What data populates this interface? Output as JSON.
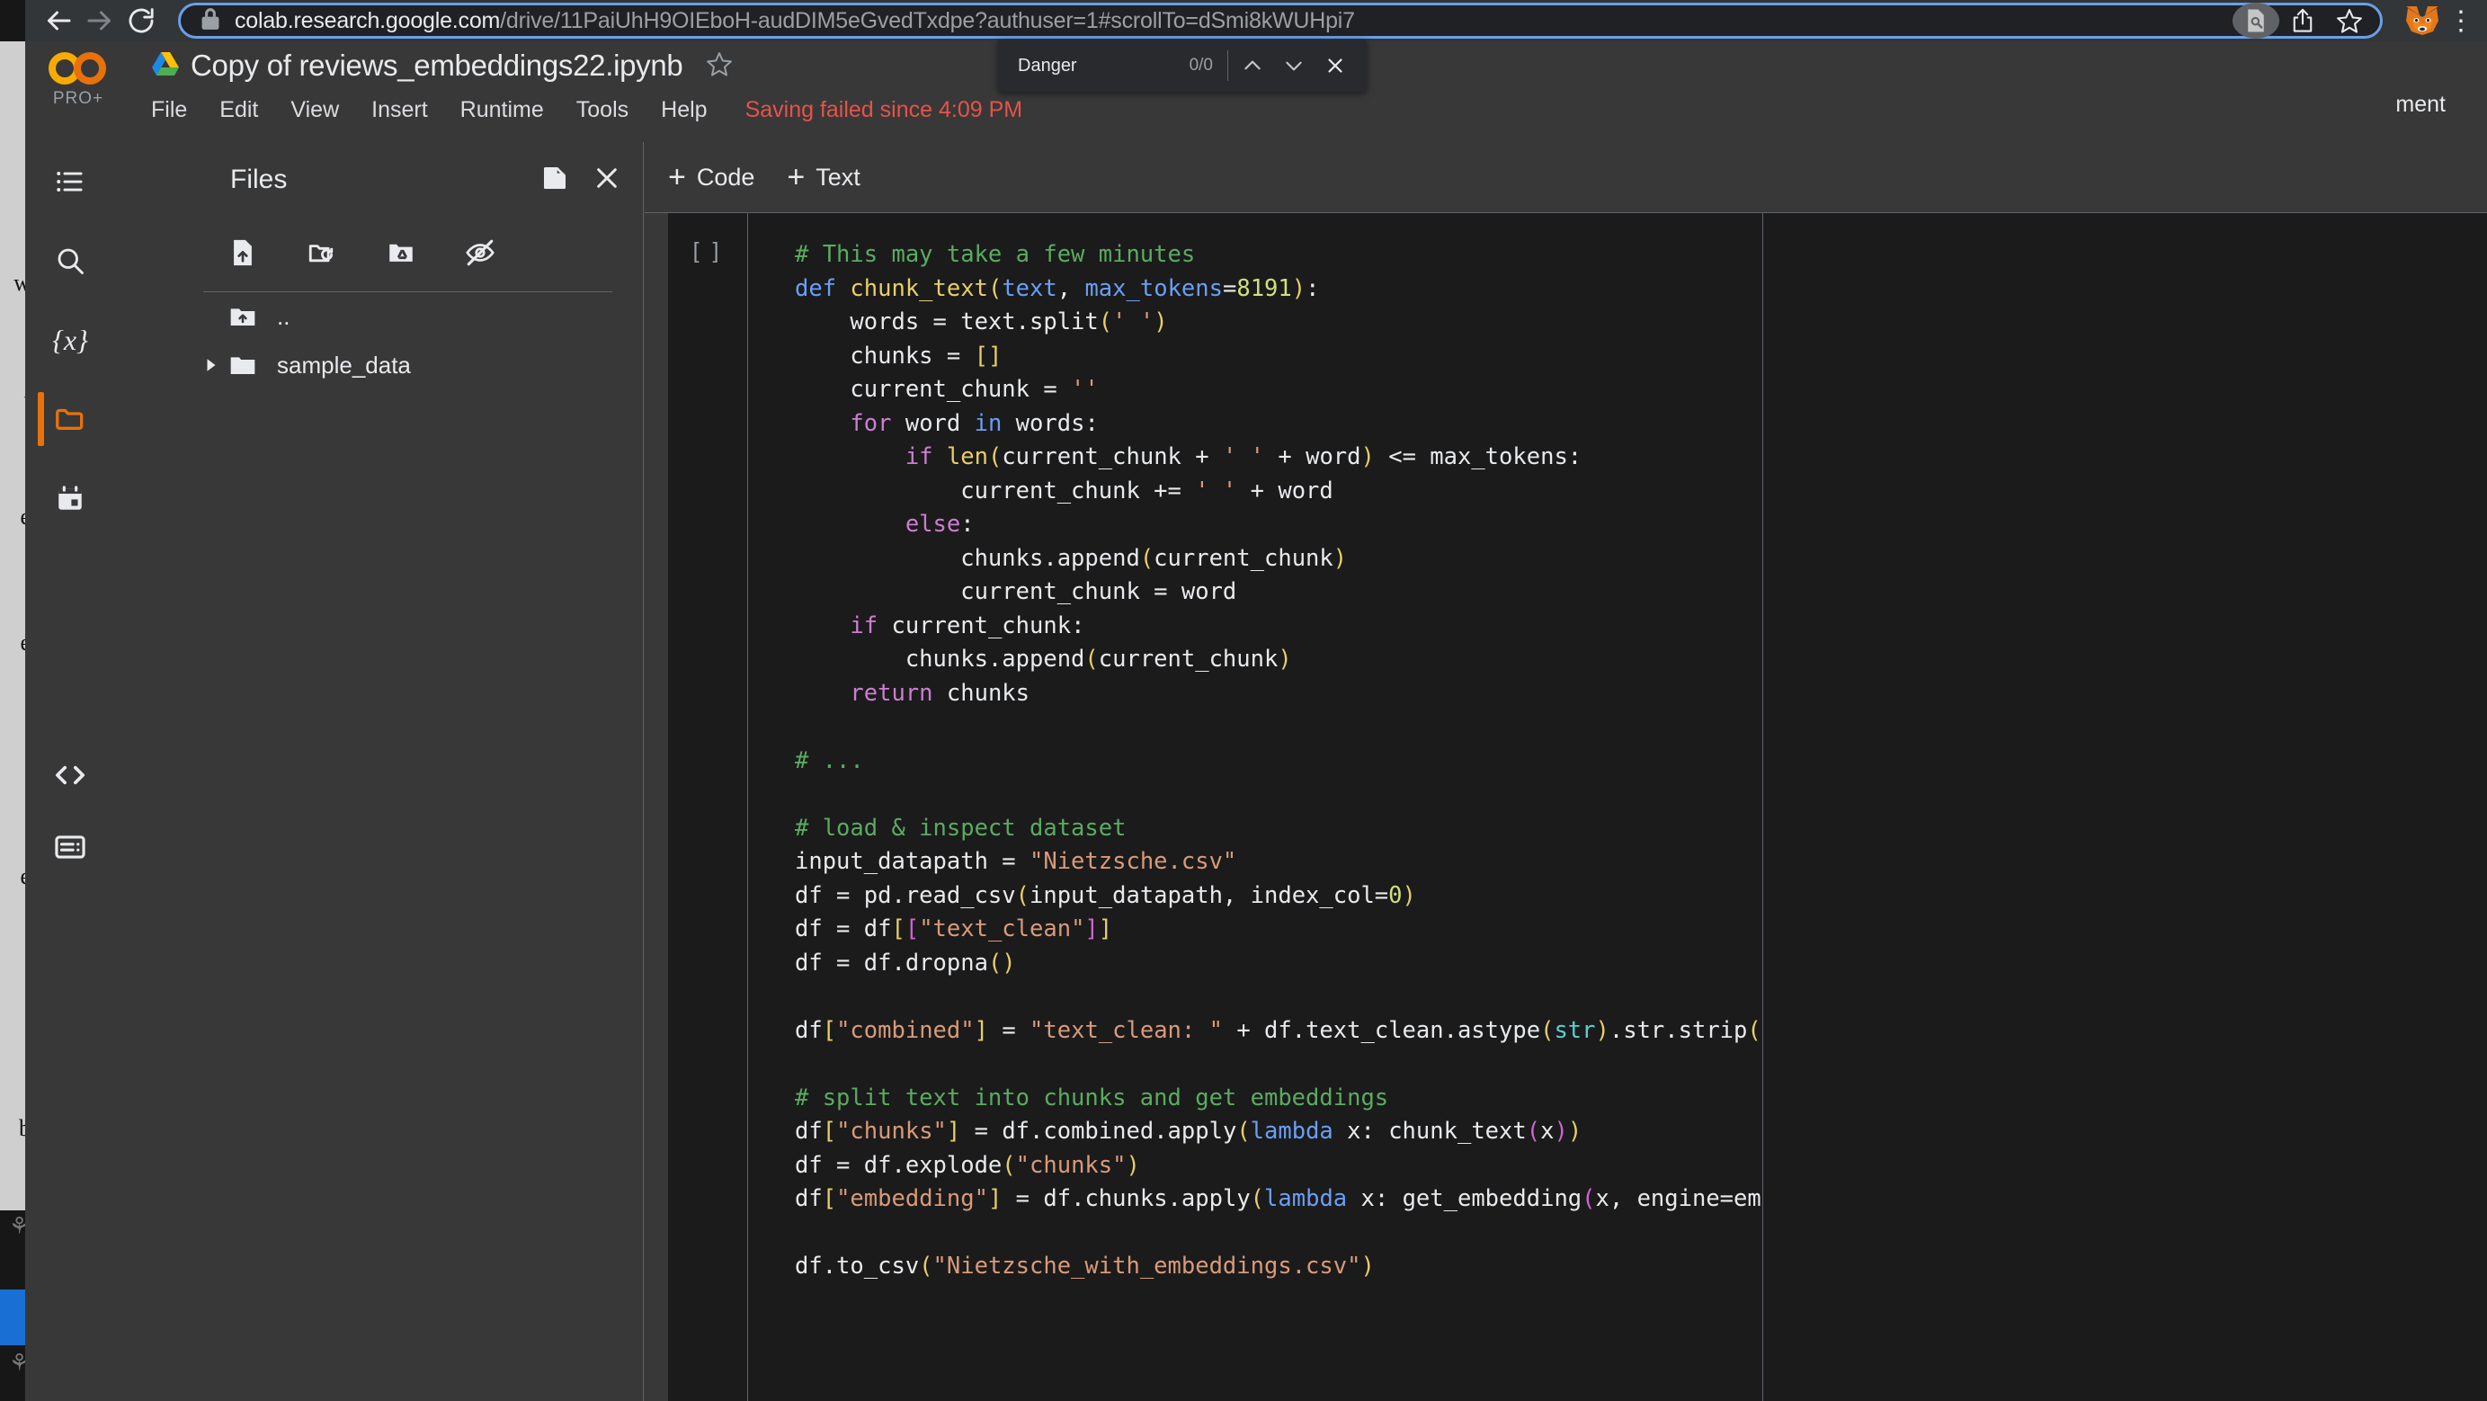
{
  "browser": {
    "back_icon": "arrow-left-icon",
    "forward_icon": "arrow-right-icon",
    "reload_icon": "reload-icon",
    "lock_icon": "lock-icon",
    "url_host": "colab.research.google.com",
    "url_path": "/drive/11PaiUhH9OIEboH-audDIM5eGvedTxdpe?authuser=1#scrollTo=dSmi8kWUHpi7",
    "url_full": "colab.research.google.com/drive/11PaiUhH9OIEboH-audDIM5eGvedTxdpe?authuser=1#scrollTo=dSmi8kWUHpi7",
    "find_page_icon": "find-in-page-icon",
    "share_icon": "share-icon",
    "bookmark_icon": "star-outline-icon",
    "extension_icon": "metamask-fox-icon"
  },
  "findbar": {
    "query": "Danger",
    "count": "0/0",
    "prev_icon": "chevron-up-icon",
    "next_icon": "chevron-down-icon",
    "close_icon": "close-icon"
  },
  "colab": {
    "logo": "colab-logo",
    "plan_badge": "PRO+",
    "drive_icon": "google-drive-icon",
    "notebook_title": "Copy of reviews_embeddings22.ipynb",
    "star_icon": "star-outline-icon",
    "menu": [
      "File",
      "Edit",
      "View",
      "Insert",
      "Runtime",
      "Tools",
      "Help"
    ],
    "save_status": "Saving failed since 4:09 PM",
    "share_label": "ment"
  },
  "rail": {
    "items": [
      {
        "name": "table-of-contents",
        "icon": "list-icon",
        "active": false
      },
      {
        "name": "find-and-replace",
        "icon": "search-icon",
        "active": false
      },
      {
        "name": "variables",
        "icon": "variables-icon",
        "label": "{x}",
        "active": false
      },
      {
        "name": "files",
        "icon": "folder-icon",
        "active": true
      },
      {
        "name": "secrets",
        "icon": "calendar-key-icon",
        "active": false
      }
    ],
    "bottom": [
      {
        "name": "code-snippets",
        "icon": "code-brackets-icon"
      },
      {
        "name": "terminal",
        "icon": "terminal-icon"
      }
    ]
  },
  "files_panel": {
    "menu_icon": "list-icon",
    "title": "Files",
    "new_window_icon": "open-in-new-icon",
    "close_icon": "close-icon",
    "toolbar": [
      {
        "name": "upload-to-session-storage",
        "icon": "file-upload-icon"
      },
      {
        "name": "refresh-folder",
        "icon": "folder-refresh-icon"
      },
      {
        "name": "mount-drive",
        "icon": "drive-mount-icon"
      },
      {
        "name": "toggle-hidden-files",
        "icon": "eye-off-icon"
      }
    ],
    "entries": [
      {
        "name": "parent-dir",
        "label": "..",
        "icon": "folder-up-icon",
        "expandable": false
      },
      {
        "name": "sample_data",
        "label": "sample_data",
        "icon": "folder-icon",
        "expandable": true
      }
    ]
  },
  "notebook": {
    "add_code_label": "Code",
    "add_text_label": "Text",
    "add_plus": "+",
    "cell": {
      "run_brackets": "[ ]",
      "lines": [
        [
          {
            "t": "# This may take a few minutes",
            "c": "c"
          }
        ],
        [
          {
            "t": "def ",
            "c": "kd"
          },
          {
            "t": "chunk_text",
            "c": "fn"
          },
          {
            "t": "(",
            "c": "p1"
          },
          {
            "t": "text",
            "c": "kd"
          },
          {
            "t": ", ",
            "c": ""
          },
          {
            "t": "max_tokens",
            "c": "kd"
          },
          {
            "t": "=",
            "c": ""
          },
          {
            "t": "8191",
            "c": "n"
          },
          {
            "t": ")",
            "c": "p1"
          },
          {
            "t": ":",
            "c": ""
          }
        ],
        [
          {
            "t": "    words = text.split",
            "c": ""
          },
          {
            "t": "(",
            "c": "p1"
          },
          {
            "t": "' '",
            "c": "s"
          },
          {
            "t": ")",
            "c": "p1"
          }
        ],
        [
          {
            "t": "    chunks = ",
            "c": ""
          },
          {
            "t": "[]",
            "c": "p1"
          }
        ],
        [
          {
            "t": "    current_chunk = ",
            "c": ""
          },
          {
            "t": "''",
            "c": "s"
          }
        ],
        [
          {
            "t": "    ",
            "c": ""
          },
          {
            "t": "for",
            "c": "k"
          },
          {
            "t": " word ",
            "c": ""
          },
          {
            "t": "in",
            "c": "kd"
          },
          {
            "t": " words:",
            "c": ""
          }
        ],
        [
          {
            "t": "        ",
            "c": ""
          },
          {
            "t": "if",
            "c": "k"
          },
          {
            "t": " ",
            "c": ""
          },
          {
            "t": "len",
            "c": "fn"
          },
          {
            "t": "(",
            "c": "p1"
          },
          {
            "t": "current_chunk + ",
            "c": ""
          },
          {
            "t": "' '",
            "c": "s"
          },
          {
            "t": " + word",
            "c": ""
          },
          {
            "t": ")",
            "c": "p1"
          },
          {
            "t": " <= max_tokens:",
            "c": ""
          }
        ],
        [
          {
            "t": "            current_chunk += ",
            "c": ""
          },
          {
            "t": "' '",
            "c": "s"
          },
          {
            "t": " + word",
            "c": ""
          }
        ],
        [
          {
            "t": "        ",
            "c": ""
          },
          {
            "t": "else",
            "c": "k"
          },
          {
            "t": ":",
            "c": ""
          }
        ],
        [
          {
            "t": "            chunks.append",
            "c": ""
          },
          {
            "t": "(",
            "c": "p1"
          },
          {
            "t": "current_chunk",
            "c": ""
          },
          {
            "t": ")",
            "c": "p1"
          }
        ],
        [
          {
            "t": "            current_chunk = word",
            "c": ""
          }
        ],
        [
          {
            "t": "    ",
            "c": ""
          },
          {
            "t": "if",
            "c": "k"
          },
          {
            "t": " current_chunk:",
            "c": ""
          }
        ],
        [
          {
            "t": "        chunks.append",
            "c": ""
          },
          {
            "t": "(",
            "c": "p1"
          },
          {
            "t": "current_chunk",
            "c": ""
          },
          {
            "t": ")",
            "c": "p1"
          }
        ],
        [
          {
            "t": "    ",
            "c": ""
          },
          {
            "t": "return",
            "c": "k"
          },
          {
            "t": " chunks",
            "c": ""
          }
        ],
        [
          {
            "t": "",
            "c": ""
          }
        ],
        [
          {
            "t": "# ...",
            "c": "c"
          }
        ],
        [
          {
            "t": "",
            "c": ""
          }
        ],
        [
          {
            "t": "# load & inspect dataset",
            "c": "c"
          }
        ],
        [
          {
            "t": "input_datapath = ",
            "c": ""
          },
          {
            "t": "\"Nietzsche.csv\"",
            "c": "s"
          }
        ],
        [
          {
            "t": "df = pd.read_csv",
            "c": ""
          },
          {
            "t": "(",
            "c": "p1"
          },
          {
            "t": "input_datapath, index_col=",
            "c": ""
          },
          {
            "t": "0",
            "c": "n"
          },
          {
            "t": ")",
            "c": "p1"
          }
        ],
        [
          {
            "t": "df = df",
            "c": ""
          },
          {
            "t": "[",
            "c": "p1"
          },
          {
            "t": "[",
            "c": "p2"
          },
          {
            "t": "\"text_clean\"",
            "c": "s"
          },
          {
            "t": "]",
            "c": "p2"
          },
          {
            "t": "]",
            "c": "p1"
          }
        ],
        [
          {
            "t": "df = df.dropna",
            "c": ""
          },
          {
            "t": "()",
            "c": "p1"
          }
        ],
        [
          {
            "t": "",
            "c": ""
          }
        ],
        [
          {
            "t": "df",
            "c": ""
          },
          {
            "t": "[",
            "c": "p1"
          },
          {
            "t": "\"combined\"",
            "c": "s"
          },
          {
            "t": "]",
            "c": "p1"
          },
          {
            "t": " = ",
            "c": ""
          },
          {
            "t": "\"text_clean: \"",
            "c": "s"
          },
          {
            "t": " + df.text_clean.astype",
            "c": ""
          },
          {
            "t": "(",
            "c": "p1"
          },
          {
            "t": "str",
            "c": "bi"
          },
          {
            "t": ")",
            "c": "p1"
          },
          {
            "t": ".str.strip",
            "c": ""
          },
          {
            "t": "()",
            "c": "p1"
          }
        ],
        [
          {
            "t": "",
            "c": ""
          }
        ],
        [
          {
            "t": "# split text into chunks and get embeddings",
            "c": "c"
          }
        ],
        [
          {
            "t": "df",
            "c": ""
          },
          {
            "t": "[",
            "c": "p1"
          },
          {
            "t": "\"chunks\"",
            "c": "s"
          },
          {
            "t": "]",
            "c": "p1"
          },
          {
            "t": " = df.combined.apply",
            "c": ""
          },
          {
            "t": "(",
            "c": "p1"
          },
          {
            "t": "lambda",
            "c": "kd"
          },
          {
            "t": " x: chunk_text",
            "c": ""
          },
          {
            "t": "(",
            "c": "p2"
          },
          {
            "t": "x",
            "c": ""
          },
          {
            "t": ")",
            "c": "p2"
          },
          {
            "t": ")",
            "c": "p1"
          }
        ],
        [
          {
            "t": "df = df.explode",
            "c": ""
          },
          {
            "t": "(",
            "c": "p1"
          },
          {
            "t": "\"chunks\"",
            "c": "s"
          },
          {
            "t": ")",
            "c": "p1"
          }
        ],
        [
          {
            "t": "df",
            "c": ""
          },
          {
            "t": "[",
            "c": "p1"
          },
          {
            "t": "\"embedding\"",
            "c": "s"
          },
          {
            "t": "]",
            "c": "p1"
          },
          {
            "t": " = df.chunks.apply",
            "c": ""
          },
          {
            "t": "(",
            "c": "p1"
          },
          {
            "t": "lambda",
            "c": "kd"
          },
          {
            "t": " x: get_embedding",
            "c": ""
          },
          {
            "t": "(",
            "c": "p2"
          },
          {
            "t": "x, engine=embedding_model",
            "c": ""
          },
          {
            "t": ")",
            "c": "p2"
          },
          {
            "t": ")",
            "c": "p1"
          }
        ],
        [
          {
            "t": "",
            "c": ""
          }
        ],
        [
          {
            "t": "df.to_csv",
            "c": ""
          },
          {
            "t": "(",
            "c": "p1"
          },
          {
            "t": "\"Nietzsche_with_embeddings.csv\"",
            "c": "s"
          },
          {
            "t": ")",
            "c": "p1"
          }
        ]
      ]
    }
  },
  "colors": {
    "accent": "#e8710a",
    "error": "#e5534b",
    "chrome_bg": "#323639",
    "page_bg": "#383838",
    "editor_bg": "#1b1b1b",
    "omnibox_focus": "#6b9fe8"
  }
}
